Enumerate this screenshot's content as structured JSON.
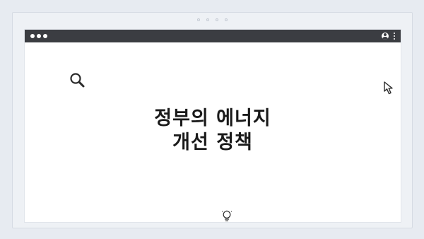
{
  "frame": {
    "dots": [
      1,
      2,
      3,
      4
    ]
  },
  "browser": {
    "titlebar": {
      "window_controls": [
        "close",
        "minimize",
        "maximize"
      ],
      "profile_icon": "profile-icon",
      "menu_icon": "kebab-menu-icon"
    }
  },
  "page": {
    "headline": {
      "line1": "정부의 에너지",
      "line2": "개선 정책"
    },
    "icons": {
      "search": "search-icon",
      "cursor": "cursor-arrow-icon",
      "bulb": "lightbulb-icon"
    }
  },
  "colors": {
    "background": "#e7ebf1",
    "titlebar": "#3b3d42",
    "content": "#ffffff",
    "text": "#1a1a1a"
  }
}
